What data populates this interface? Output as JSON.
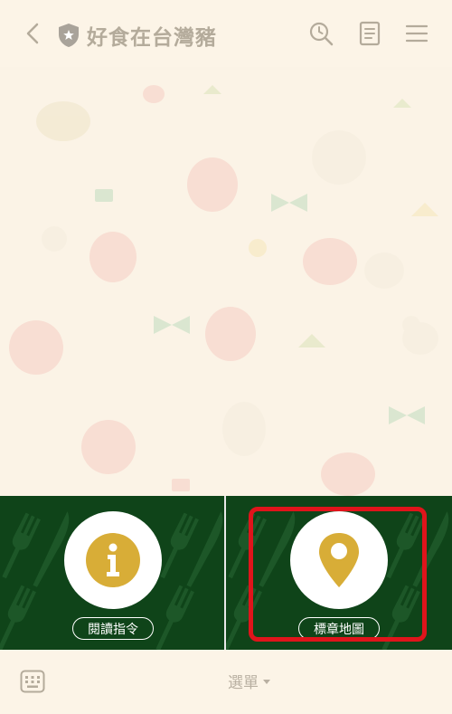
{
  "header": {
    "title": "好食在台灣豬",
    "back_icon": "chevron-left-icon",
    "badge_icon": "shield-star-icon",
    "search_icon": "clock-search-icon",
    "notes_icon": "notes-icon",
    "menu_icon": "hamburger-menu-icon"
  },
  "rich_menu": {
    "items": [
      {
        "label": "閱讀指令",
        "icon": "info-icon"
      },
      {
        "label": "標章地圖",
        "icon": "map-pin-icon"
      }
    ],
    "background_color": "#0f4419",
    "accent_color": "#d8ad37",
    "highlight_color": "#e0141b"
  },
  "bottom_bar": {
    "keyboard_icon": "keyboard-icon",
    "menu_label": "選單"
  }
}
